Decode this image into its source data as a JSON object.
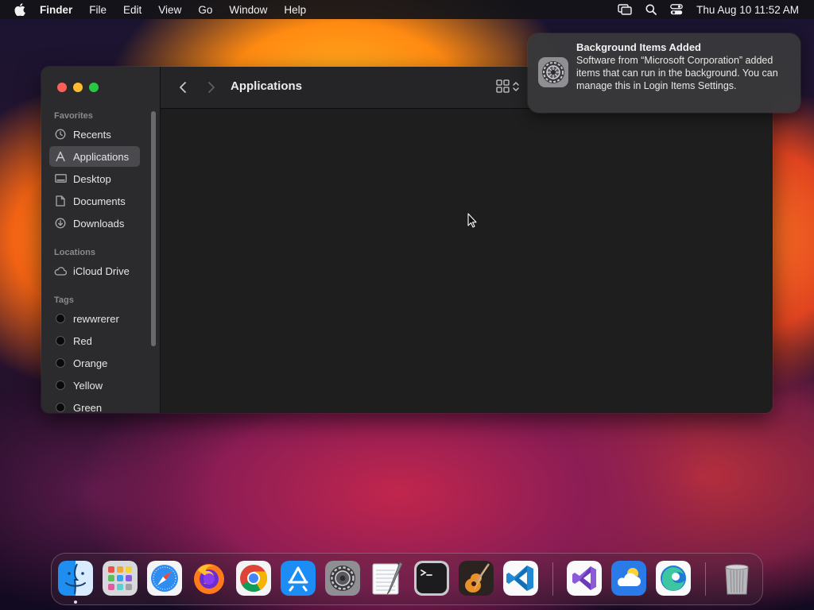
{
  "menubar": {
    "items": [
      "Finder",
      "File",
      "Edit",
      "View",
      "Go",
      "Window",
      "Help"
    ],
    "clock": "Thu Aug 10  11:52 AM",
    "status_icons": [
      "screen-mirroring-icon",
      "search-icon",
      "control-center-icon"
    ]
  },
  "finder": {
    "title": "Applications",
    "sidebar": {
      "favorites_label": "Favorites",
      "favorites": [
        {
          "label": "Recents",
          "icon": "clock-icon"
        },
        {
          "label": "Applications",
          "icon": "applications-icon",
          "active": true
        },
        {
          "label": "Desktop",
          "icon": "desktop-icon"
        },
        {
          "label": "Documents",
          "icon": "document-icon"
        },
        {
          "label": "Downloads",
          "icon": "download-icon"
        }
      ],
      "locations_label": "Locations",
      "locations": [
        {
          "label": "iCloud Drive",
          "icon": "cloud-icon"
        }
      ],
      "tags_label": "Tags",
      "tags": [
        {
          "label": "rewwrerer"
        },
        {
          "label": "Red"
        },
        {
          "label": "Orange"
        },
        {
          "label": "Yellow"
        },
        {
          "label": "Green"
        }
      ]
    }
  },
  "notification": {
    "title": "Background Items Added",
    "body": "Software from “Microsoft Corporation” added items that can run in the background. You can manage this in Login Items Settings.",
    "icon": "system-settings-icon"
  },
  "dock": {
    "apps": [
      "Finder",
      "Launchpad",
      "Safari",
      "Firefox",
      "Chrome",
      "App Store",
      "System Settings",
      "TextEdit",
      "Terminal",
      "GarageBand",
      "Visual Studio Code",
      "Visual Studio",
      "Weather",
      "Microsoft Edge",
      "Trash"
    ]
  },
  "colors": {
    "close": "#ff5f57",
    "minimize": "#febc2e",
    "maximize": "#28c840"
  }
}
